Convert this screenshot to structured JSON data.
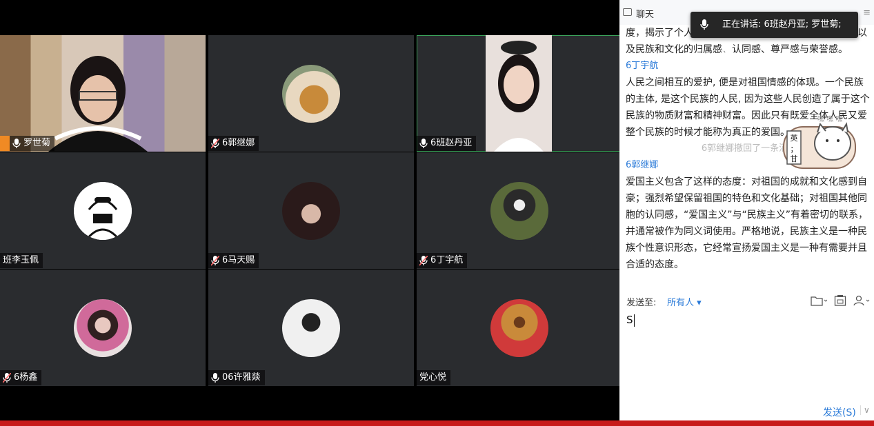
{
  "tiles": [
    {
      "name": "罗世菊",
      "mic": "on",
      "host": true,
      "kind": "camera"
    },
    {
      "name": "6郭继娜",
      "mic": "muted",
      "kind": "avatar",
      "avatar": "dog-photo"
    },
    {
      "name": "6班赵丹亚",
      "mic": "on",
      "kind": "camera-portrait",
      "speaking": true
    },
    {
      "name": "班李玉佩",
      "mic": "none",
      "kind": "avatar",
      "avatar": "cartoon-sketch"
    },
    {
      "name": "6马天赐",
      "mic": "muted",
      "kind": "avatar",
      "avatar": "girl-dark-photo"
    },
    {
      "name": "6丁宇航",
      "mic": "muted",
      "kind": "avatar",
      "avatar": "heart-hands-photo"
    },
    {
      "name": "6杨鑫",
      "mic": "muted",
      "kind": "avatar",
      "avatar": "pink-girl-photo"
    },
    {
      "name": "06许雅燚",
      "mic": "on",
      "kind": "avatar",
      "avatar": "masked-boy-photo"
    },
    {
      "name": "党心悦",
      "mic": "none",
      "kind": "avatar",
      "avatar": "bear-photo"
    }
  ],
  "chat": {
    "title": "聊天",
    "speaking_popup": "正在讲话: 6班赵丹亚; 罗世菊; 0...",
    "messages": [
      {
        "text": "度，揭示了个人与祖国的依存关系，是人们对自己家园以及民族和文化的归属感、认同感、尊严感与荣誉感。"
      },
      {
        "sender": "6丁宇航",
        "text": "人民之间相互的爱护, 便是对祖国情感的体现。一个民族的主体, 是这个民族的人民, 因为这些人民创造了属于这个民族的物质财富和精神财富。因此只有既爱全体人民又爱整个民族的时候才能称为真正的爱国。"
      },
      {
        "recall": "6郭继娜撤回了一条消息"
      },
      {
        "sender": "6郭继娜",
        "text": "爱国主义包含了这样的态度：对祖国的成就和文化感到自豪；强烈希望保留祖国的特色和文化基础；对祖国其他同胞的认同感，“爱国主义”与“民族主义”有着密切的联系，并通常被作为同义词使用。严格地说，民族主义是一种民族个性意识形态，它经常宣扬爱国主义是一种有需要并且合适的态度。"
      }
    ],
    "sticker_text": "英；甘",
    "send_to_label": "发送至:",
    "send_to_value": "所有人",
    "input_value": "S",
    "send_button": "发送(S)"
  },
  "colors": {
    "accent": "#2a7ad8",
    "tile_bg": "#2a2c2f",
    "speaking_border": "#3aa35a",
    "host_badge": "#f08a24"
  }
}
